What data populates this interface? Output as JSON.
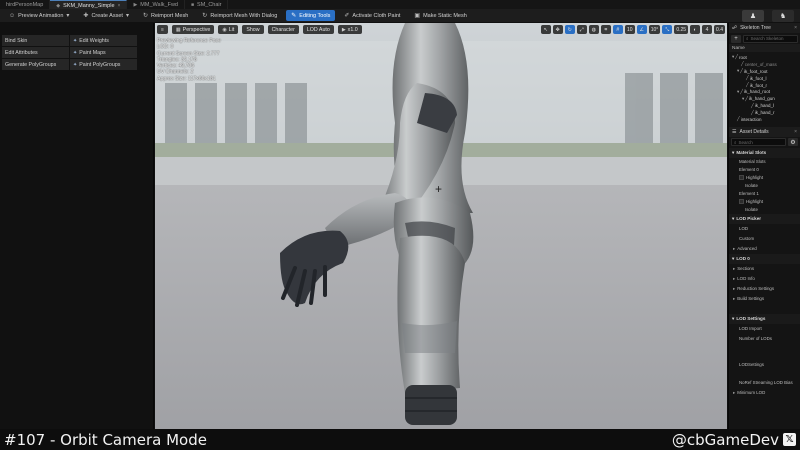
{
  "tabs": [
    {
      "label": "hirdPersonMap",
      "icon": "level-icon"
    },
    {
      "label": "SKM_Manny_Simple",
      "icon": "skeletal-mesh-icon",
      "active": true
    },
    {
      "label": "MM_Walk_Fwd",
      "icon": "animation-icon"
    },
    {
      "label": "SM_Chair",
      "icon": "static-mesh-icon"
    }
  ],
  "toolbar": {
    "preview_animation": "Preview Animation",
    "create_asset": "Create Asset",
    "reimport_mesh": "Reimport Mesh",
    "reimport_mesh_dialog": "Reimport Mesh With Dialog",
    "editing_tools": "Editing Tools",
    "activate_cloth_paint": "Activate Cloth Paint",
    "make_static_mesh": "Make Static Mesh"
  },
  "tools": [
    {
      "label": "Bind Skin"
    },
    {
      "label": "Edit Weights"
    },
    {
      "label": "Edit Attributes"
    },
    {
      "label": "Paint Maps"
    },
    {
      "label": "Generate PolyGroups"
    },
    {
      "label": "Paint PolyGroups"
    }
  ],
  "viewport": {
    "menu": "≡",
    "perspective": "Perspective",
    "lit": "Lit",
    "show": "Show",
    "character": "Character",
    "lod": "LOD Auto",
    "speed": "x1.0",
    "right_chips": [
      "10",
      "10°",
      "0.25",
      "4",
      "0.4"
    ],
    "stats": [
      "Previewing Reference Pose",
      "LOD: 0",
      "Current Screen Size: 2.777",
      "Triangles: 32,178",
      "Vertices: 49,706",
      "UV Channels: 2",
      "Approx Size: 117x66x181"
    ]
  },
  "skeleton_tree": {
    "title": "Skeleton Tree",
    "search_placeholder": "Search Skeleton",
    "column": "Name",
    "items": [
      {
        "label": "root",
        "depth": 0,
        "icon": "bone-icon"
      },
      {
        "label": "center_of_mass",
        "depth": 1,
        "icon": "bone-icon",
        "dim": true
      },
      {
        "label": "ik_foot_root",
        "depth": 1,
        "icon": "bone-icon"
      },
      {
        "label": "ik_foot_l",
        "depth": 2,
        "icon": "bone-icon"
      },
      {
        "label": "ik_foot_r",
        "depth": 2,
        "icon": "bone-icon"
      },
      {
        "label": "ik_hand_root",
        "depth": 1,
        "icon": "bone-icon"
      },
      {
        "label": "ik_hand_gun",
        "depth": 2,
        "icon": "bone-icon"
      },
      {
        "label": "ik_hand_l",
        "depth": 3,
        "icon": "bone-icon"
      },
      {
        "label": "ik_hand_r",
        "depth": 3,
        "icon": "bone-icon"
      },
      {
        "label": "interaction",
        "depth": 1,
        "icon": "bone-icon"
      }
    ]
  },
  "asset_details": {
    "title": "Asset Details",
    "search_placeholder": "Search",
    "sections": [
      {
        "header": "Material Slots",
        "rows": [
          "Material Slots",
          "Element 0",
          "Highlight",
          "Isolate",
          "Element 1",
          "Highlight",
          "Isolate"
        ]
      },
      {
        "header": "LOD Picker",
        "rows": [
          "LOD",
          "Custom",
          "Advanced"
        ]
      },
      {
        "header": "LOD 0",
        "rows": [
          "Sections",
          "LOD Info",
          "Reduction Settings",
          "Build Settings"
        ]
      },
      {
        "header": "LOD Settings",
        "rows": [
          "LOD Import",
          "Number of LODs",
          "LODSettings",
          "NoRef Streaming LOD Bias",
          "Minimum LOD"
        ]
      }
    ]
  },
  "caption": {
    "title": "#107 - Orbit Camera Mode",
    "handle": "@cbGameDev",
    "icon": "x-logo-icon"
  },
  "colors": {
    "accent": "#2a6fc4",
    "panel": "#141414",
    "floor": "#a9aaad"
  }
}
